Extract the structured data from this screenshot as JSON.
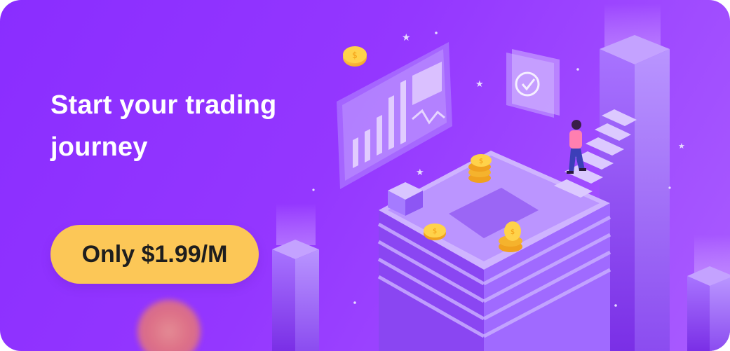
{
  "banner": {
    "headline": "Start your trading journey",
    "cta_label": "Only $1.99/M"
  },
  "colors": {
    "background": "#9437ff",
    "cta_background": "#fcc757",
    "cta_text": "#1e1e1e",
    "headline_text": "#ffffff"
  },
  "icons": [
    "checkmark-icon",
    "coin-icon",
    "chart-icon",
    "star-icon"
  ]
}
